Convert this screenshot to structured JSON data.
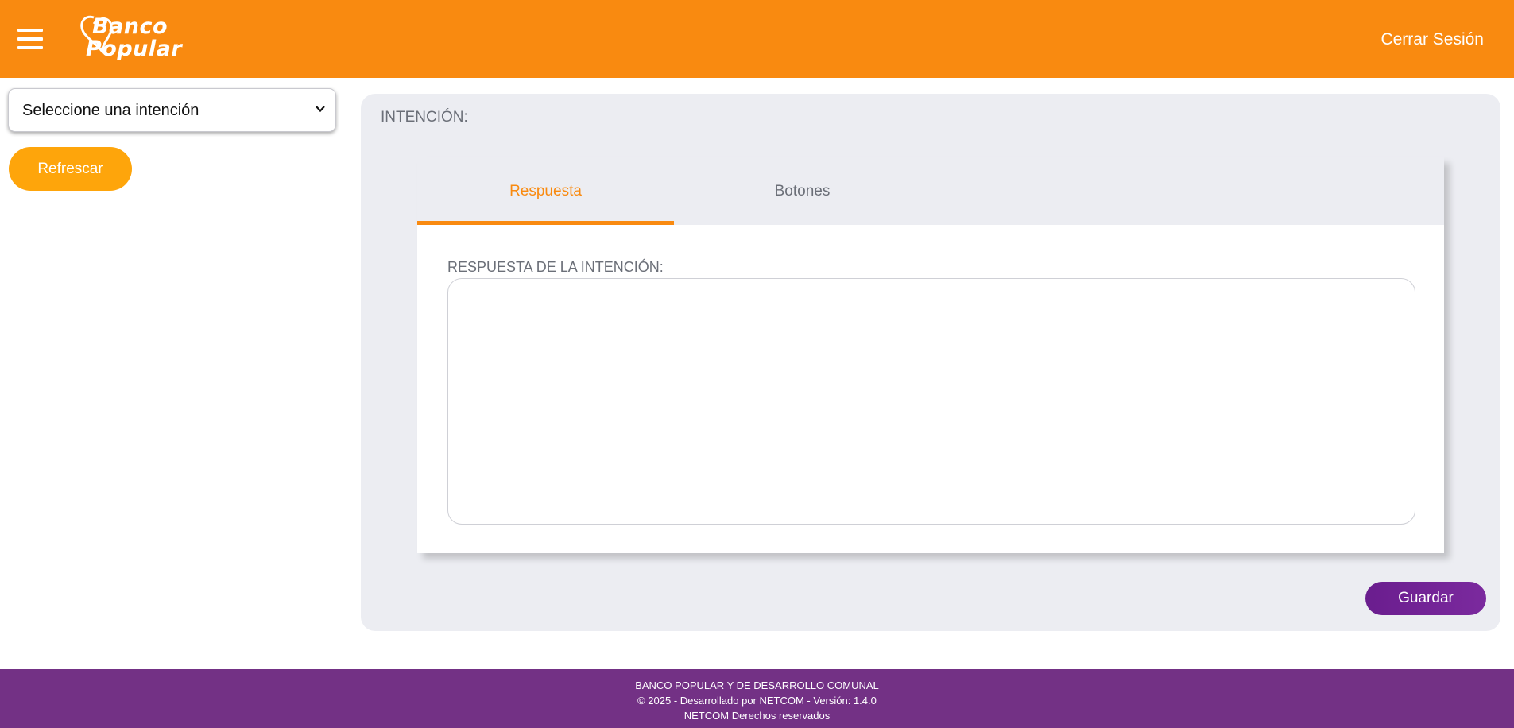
{
  "header": {
    "logo_line1": "Banco",
    "logo_line2": "Popular",
    "logout_label": "Cerrar Sesión",
    "menu_icon": "hamburger-menu-icon"
  },
  "sidebar": {
    "intent_select": {
      "selected": "Seleccione una intención",
      "icon": "chevron-down-icon"
    },
    "refresh_label": "Refrescar"
  },
  "main": {
    "title": "INTENCIÓN:",
    "tabs": [
      {
        "label": "Respuesta",
        "active": true
      },
      {
        "label": "Botones",
        "active": false
      }
    ],
    "answer_label": "RESPUESTA DE LA INTENCIÓN:",
    "answer_value": "",
    "save_label": "Guardar"
  },
  "footer": {
    "line1": "BANCO POPULAR Y DE DESARROLLO COMUNAL",
    "line2": "© 2025 - Desarrollado por NETCOM - Versión: 1.4.0",
    "line3": "NETCOM Derechos reservados"
  },
  "colors": {
    "header": "#f98a10",
    "refresh_button": "#fea50b",
    "save_button": "#6a1d8e",
    "footer": "#733185",
    "panel": "#ecedf2"
  }
}
